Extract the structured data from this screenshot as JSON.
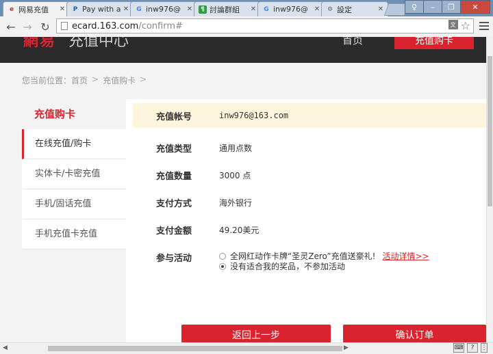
{
  "browser": {
    "tabs": [
      {
        "label": "网易充值",
        "icon": "netease-icon",
        "icon_text": "e",
        "icon_color": "#d9232e",
        "active": true
      },
      {
        "label": "Pay with a",
        "icon": "paypal-icon",
        "icon_text": "P",
        "icon_color": "#1b5fab",
        "active": false
      },
      {
        "label": "inw976@",
        "icon": "google-icon",
        "icon_text": "G",
        "icon_color": "#4285f4",
        "active": false
      },
      {
        "label": "討論群組",
        "icon": "chat-icon",
        "icon_text": "¶",
        "icon_color": "#2e9b43",
        "active": false
      },
      {
        "label": "inw976@",
        "icon": "google-icon",
        "icon_text": "G",
        "icon_color": "#4285f4",
        "active": false
      },
      {
        "label": "設定",
        "icon": "gear-icon",
        "icon_text": "⚙",
        "icon_color": "#666666",
        "active": false
      }
    ],
    "url_host": "ecard.163.com",
    "url_path": "/confirm#"
  },
  "header": {
    "logo": "網易",
    "logo_suffix": "充值中心",
    "nav_home": "首页",
    "nav_buy": "充值购卡"
  },
  "breadcrumb": {
    "prefix": "您当前位置：",
    "items": [
      "首页",
      "充值购卡"
    ]
  },
  "sidebar": {
    "title": "充值购卡",
    "items": [
      {
        "label": "在线充值/购卡",
        "active": true
      },
      {
        "label": "实体卡/卡密充值",
        "active": false
      },
      {
        "label": "手机/固话充值",
        "active": false
      },
      {
        "label": "手机充值卡充值",
        "active": false
      }
    ]
  },
  "form": {
    "account_label": "充值帐号",
    "account_value": "inw976@163.com",
    "type_label": "充值类型",
    "type_value": "通用点数",
    "amount_label": "充值数量",
    "amount_value": "3000 点",
    "payment_label": "支付方式",
    "payment_value": "海外银行",
    "price_label": "支付金额",
    "price_value": "49.20美元",
    "activity_label": "参与活动",
    "activity_option1": "全网红动作卡牌“圣灵Zero”充值送豪礼!",
    "activity_detail_link": "活动详情>>",
    "activity_option2": "没有适合我的奖品，不参加活动"
  },
  "buttons": {
    "back": "返回上一步",
    "confirm": "确认订单"
  },
  "colors": {
    "brand_red": "#d9232e",
    "highlight_row": "#fdf6dc"
  }
}
